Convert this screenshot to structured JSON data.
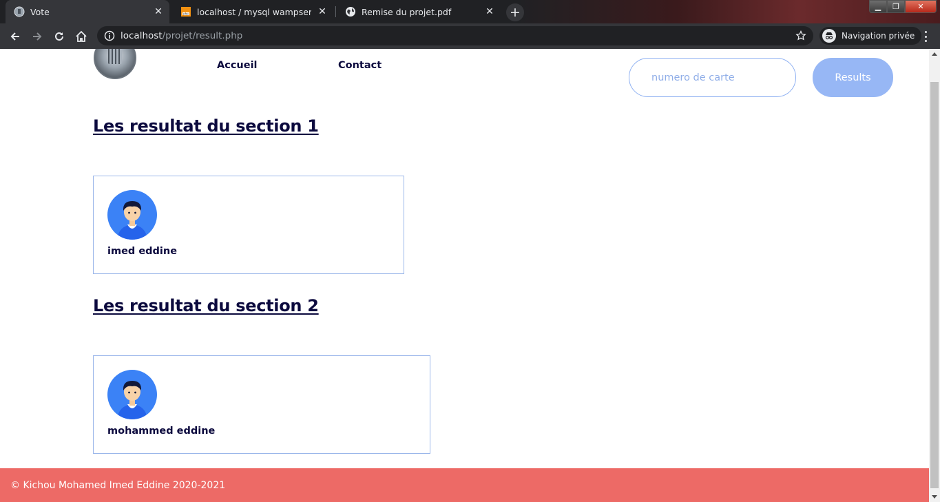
{
  "browser": {
    "tabs": [
      {
        "title": "Vote",
        "favicon": "site-logo-icon",
        "active": true
      },
      {
        "title": "localhost / mysql wampserver / in",
        "favicon": "phpmyadmin-icon",
        "active": false
      },
      {
        "title": "Remise du projet.pdf",
        "favicon": "globe-icon",
        "active": false
      }
    ],
    "url_host": "localhost",
    "url_path": "/projet/result.php",
    "incognito_label": "Navigation privée"
  },
  "nav": {
    "links": [
      "Accueil",
      "Contact"
    ],
    "search_placeholder": "numero de carte",
    "results_label": "Results"
  },
  "sections": [
    {
      "title": "Les resultat du section 1",
      "winner": "imed eddine"
    },
    {
      "title": "Les resultat du section 2",
      "winner": "mohammed eddine"
    }
  ],
  "footer": {
    "text": "© Kichou Mohamed Imed Eddine 2020-2021"
  },
  "colors": {
    "heading": "#0c0a3e",
    "accent_button": "#97b7f5",
    "card_border": "#9ab6ea",
    "footer_bg": "#ed6a66",
    "avatar_bg": "#3b82f6"
  }
}
